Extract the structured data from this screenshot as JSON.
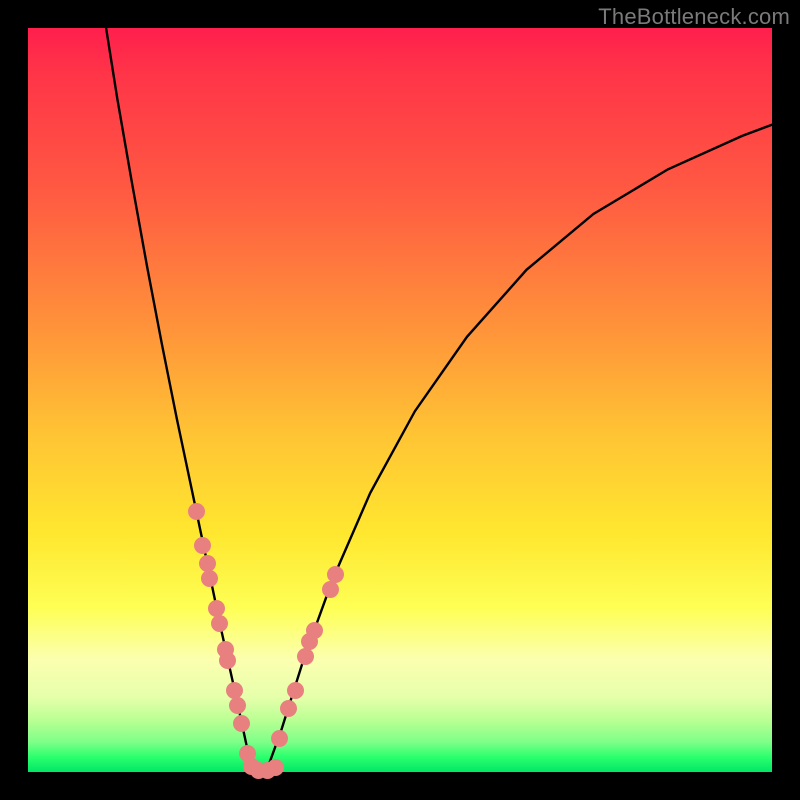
{
  "watermark": "TheBottleneck.com",
  "colors": {
    "dot": "#e98080",
    "curve": "#000000",
    "frame": "#000000"
  },
  "chart_data": {
    "type": "line",
    "title": "",
    "xlabel": "",
    "ylabel": "",
    "xlim": [
      0,
      100
    ],
    "ylim": [
      0,
      100
    ],
    "grid": false,
    "legend": false,
    "note": "Axes unlabeled in source; x interpreted as hardware-balance parameter (0–100), y as bottleneck percentage (0=best, 100=worst). Values estimated from pixel geometry.",
    "curve": {
      "description": "V-shaped bottleneck curve, minimum at x≈30.5, y≈0",
      "points_xy": [
        [
          10.5,
          100.0
        ],
        [
          12.0,
          90.5
        ],
        [
          14.0,
          79.0
        ],
        [
          16.0,
          68.0
        ],
        [
          18.0,
          57.5
        ],
        [
          20.0,
          47.5
        ],
        [
          22.0,
          38.0
        ],
        [
          24.0,
          28.5
        ],
        [
          26.0,
          19.0
        ],
        [
          28.0,
          10.0
        ],
        [
          29.5,
          3.0
        ],
        [
          30.5,
          0.0
        ],
        [
          32.0,
          0.0
        ],
        [
          34.0,
          5.5
        ],
        [
          37.0,
          15.0
        ],
        [
          41.0,
          26.0
        ],
        [
          46.0,
          37.5
        ],
        [
          52.0,
          48.5
        ],
        [
          59.0,
          58.5
        ],
        [
          67.0,
          67.5
        ],
        [
          76.0,
          75.0
        ],
        [
          86.0,
          81.0
        ],
        [
          96.0,
          85.5
        ],
        [
          100.0,
          87.0
        ]
      ]
    },
    "markers": {
      "description": "Salmon dots clustered near the curve minimum on both branches",
      "points_xy": [
        [
          22.6,
          35.0
        ],
        [
          23.5,
          30.5
        ],
        [
          24.1,
          28.0
        ],
        [
          24.4,
          26.0
        ],
        [
          25.4,
          22.0
        ],
        [
          25.8,
          20.0
        ],
        [
          26.6,
          16.5
        ],
        [
          26.8,
          15.0
        ],
        [
          27.7,
          11.0
        ],
        [
          28.2,
          9.0
        ],
        [
          28.7,
          6.5
        ],
        [
          29.5,
          2.5
        ],
        [
          30.0,
          0.8
        ],
        [
          31.0,
          0.2
        ],
        [
          32.2,
          0.2
        ],
        [
          33.3,
          0.6
        ],
        [
          33.8,
          4.5
        ],
        [
          35.0,
          8.5
        ],
        [
          35.9,
          11.0
        ],
        [
          37.3,
          15.5
        ],
        [
          37.9,
          17.5
        ],
        [
          38.5,
          19.0
        ],
        [
          40.6,
          24.5
        ],
        [
          41.3,
          26.5
        ]
      ]
    }
  }
}
